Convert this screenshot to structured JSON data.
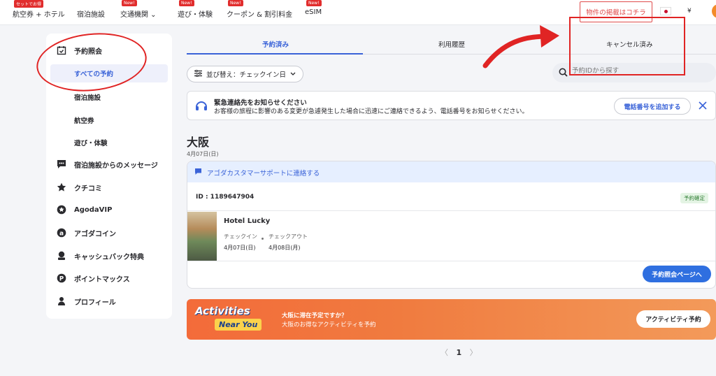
{
  "topnav": {
    "items": [
      {
        "label": "航空券 + ホテル",
        "badge": "セットでお得"
      },
      {
        "label": "宿泊施設",
        "badge": ""
      },
      {
        "label": "交通機関 ⌄",
        "badge": "New!"
      },
      {
        "label": "遊び・体験",
        "badge": "New!"
      },
      {
        "label": "クーポン & 割引料金",
        "badge": "New!"
      },
      {
        "label": "eSIM",
        "badge": "New!"
      }
    ],
    "list_property": "物件の掲載はコチラ",
    "currency": "¥"
  },
  "sidebar": {
    "bookings": "予約照会",
    "all_bookings": "すべての予約",
    "sub": [
      "宿泊施設",
      "航空券",
      "遊び・体験"
    ],
    "items": [
      "宿泊施設からのメッセージ",
      "クチコミ",
      "AgodaVIP",
      "アゴダコイン",
      "キャッシュバック特典",
      "ポイントマックス",
      "プロフィール"
    ]
  },
  "tabs": [
    "予約済み",
    "利用履歴",
    "キャンセル済み"
  ],
  "sort_label": "並び替え：チェックイン日",
  "search_placeholder": "予約IDから探す",
  "notice": {
    "title": "緊急連絡先をお知らせください",
    "body": "お客様の旅程に影響のある変更が急遽発生した場合に迅速にご連絡できるよう、電話番号をお知らせください。",
    "button": "電話番号を追加する"
  },
  "city": "大阪",
  "city_date": "4月07日(日)",
  "booking": {
    "support": "アゴダカスタマーサポートに連絡する",
    "id": "ID : 1189647904",
    "status": "予約確定",
    "hotel": "Hotel Lucky",
    "checkin_label": "チェックイン",
    "checkout_label": "チェックアウト",
    "checkin_date": "4月07日(日)",
    "checkout_date": "4月08日(月)",
    "manage": "予約照会ページへ"
  },
  "activities": {
    "logo_line1": "Activities",
    "logo_line2": "Near You",
    "question": "大阪に滞在予定ですか？",
    "sub": "大阪のお得なアクティビティを予約",
    "button": "アクティビティ予約"
  },
  "pager": {
    "prev": "〈",
    "current": "1",
    "next": "〉"
  },
  "colors": {
    "accent": "#3a63d8",
    "annotation": "#e02424",
    "banner": "#f36b3a"
  }
}
